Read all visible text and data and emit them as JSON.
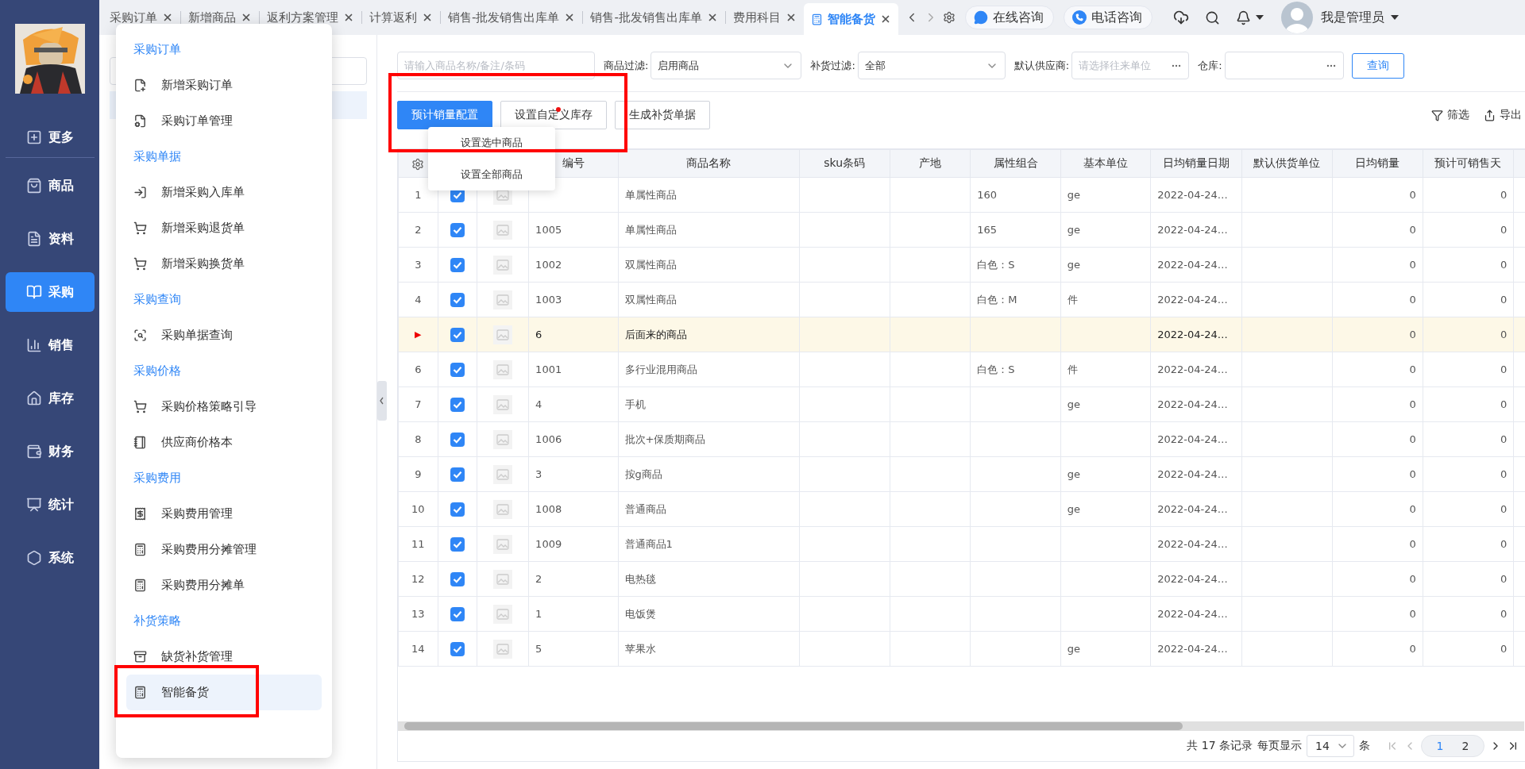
{
  "sidebar": {
    "items": [
      {
        "label": "更多",
        "selected": false
      },
      {
        "label": "商品",
        "selected": false
      },
      {
        "label": "资料",
        "selected": false
      },
      {
        "label": "采购",
        "selected": true
      },
      {
        "label": "销售",
        "selected": false
      },
      {
        "label": "库存",
        "selected": false
      },
      {
        "label": "财务",
        "selected": false
      },
      {
        "label": "统计",
        "selected": false
      },
      {
        "label": "系统",
        "selected": false
      }
    ]
  },
  "tabs": [
    {
      "label": "采购订单",
      "selected": false
    },
    {
      "label": "新增商品",
      "selected": false
    },
    {
      "label": "返利方案管理",
      "selected": false
    },
    {
      "label": "计算返利",
      "selected": false
    },
    {
      "label": "销售-批发销售出库单",
      "selected": false
    },
    {
      "label": "销售-批发销售出库单",
      "selected": false
    },
    {
      "label": "费用科目",
      "selected": false
    },
    {
      "label": "智能备货",
      "selected": true
    }
  ],
  "header": {
    "consult": [
      {
        "kind": "chat",
        "label": "在线咨询"
      },
      {
        "kind": "phone",
        "label": "电话咨询"
      }
    ],
    "user": "我是管理员"
  },
  "menu": {
    "groups": [
      {
        "title": "采购订单",
        "items": [
          {
            "label": "新增采购订单",
            "selected": false,
            "highlighted": false
          },
          {
            "label": "采购订单管理",
            "selected": false,
            "highlighted": false
          }
        ]
      },
      {
        "title": "采购单据",
        "items": [
          {
            "label": "新增采购入库单",
            "selected": false,
            "highlighted": false
          },
          {
            "label": "新增采购退货单",
            "selected": false,
            "highlighted": false
          },
          {
            "label": "新增采购换货单",
            "selected": false,
            "highlighted": false
          }
        ]
      },
      {
        "title": "采购查询",
        "items": [
          {
            "label": "采购单据查询",
            "selected": false,
            "highlighted": false
          }
        ]
      },
      {
        "title": "采购价格",
        "items": [
          {
            "label": "采购价格策略引导",
            "selected": false,
            "highlighted": false
          },
          {
            "label": "供应商价格本",
            "selected": false,
            "highlighted": false
          }
        ]
      },
      {
        "title": "采购费用",
        "items": [
          {
            "label": "采购费用管理",
            "selected": false,
            "highlighted": false
          },
          {
            "label": "采购费用分摊管理",
            "selected": false,
            "highlighted": false
          },
          {
            "label": "采购费用分摊单",
            "selected": false,
            "highlighted": false
          }
        ]
      },
      {
        "title": "补货策略",
        "items": [
          {
            "label": "缺货补货管理",
            "selected": false,
            "highlighted": false
          },
          {
            "label": "智能备货",
            "selected": true,
            "highlighted": true
          }
        ]
      }
    ]
  },
  "filters": {
    "search": {
      "placeholder": "请输入商品名称/备注/条码"
    },
    "product_filter": {
      "label": "商品过滤:",
      "value": "启用商品"
    },
    "restock_filter": {
      "label": "补货过滤:",
      "value": "全部"
    },
    "supplier": {
      "label": "默认供应商:",
      "placeholder": "请选择往来单位"
    },
    "warehouse": {
      "label": "仓库:"
    },
    "query_button": "查询"
  },
  "toolbar": {
    "highlighted": true,
    "buttons": [
      {
        "label": "预计销量配置",
        "primary": true,
        "marker": false
      },
      {
        "label": "设置自定义库存",
        "primary": false,
        "marker": true
      },
      {
        "label": "生成补货单据",
        "primary": false,
        "marker": false
      }
    ],
    "tools": [
      {
        "kind": "filter",
        "label": "筛选"
      },
      {
        "kind": "export",
        "label": "导出"
      }
    ]
  },
  "dropdown": {
    "items": [
      "设置选中商品",
      "设置全部商品"
    ]
  },
  "table": {
    "columns": [
      {
        "label": "编号"
      },
      {
        "label": "商品名称"
      },
      {
        "label": "sku条码"
      },
      {
        "label": "产地"
      },
      {
        "label": "属性组合"
      },
      {
        "label": "基本单位"
      },
      {
        "label": "日均销量日期"
      },
      {
        "label": "默认供货单位"
      },
      {
        "label": "日均销量"
      },
      {
        "label": "预计可销售天"
      }
    ],
    "rows": [
      {
        "index": "1",
        "current": false,
        "checked": true,
        "name": "单属性商品",
        "attributes": "160",
        "unit": "ge",
        "date": "2022-04-24…",
        "daily_sales": "0",
        "days": "0"
      },
      {
        "index": "2",
        "current": false,
        "checked": true,
        "code": "1005",
        "name": "单属性商品",
        "attributes": "165",
        "unit": "ge",
        "date": "2022-04-24…",
        "daily_sales": "0",
        "days": "0"
      },
      {
        "index": "3",
        "current": false,
        "checked": true,
        "code": "1002",
        "name": "双属性商品",
        "attributes": "白色：S",
        "unit": "ge",
        "date": "2022-04-24…",
        "daily_sales": "0",
        "days": "0"
      },
      {
        "index": "4",
        "current": false,
        "checked": true,
        "code": "1003",
        "name": "双属性商品",
        "attributes": "白色：M",
        "unit": "件",
        "date": "2022-04-24…",
        "daily_sales": "0",
        "days": "0"
      },
      {
        "index": "▶",
        "current": true,
        "checked": true,
        "code": "6",
        "name": "后面来的商品",
        "date": "2022-04-24…",
        "daily_sales": "0",
        "days": "0"
      },
      {
        "index": "6",
        "current": false,
        "checked": true,
        "code": "1001",
        "name": "多行业混用商品",
        "attributes": "白色：S",
        "unit": "件",
        "date": "2022-04-24…",
        "daily_sales": "0",
        "days": "0"
      },
      {
        "index": "7",
        "current": false,
        "checked": true,
        "code": "4",
        "name": "手机",
        "unit": "ge",
        "date": "2022-04-24…",
        "daily_sales": "0",
        "days": "0"
      },
      {
        "index": "8",
        "current": false,
        "checked": true,
        "code": "1006",
        "name": "批次+保质期商品",
        "date": "2022-04-24…",
        "daily_sales": "0",
        "days": "0"
      },
      {
        "index": "9",
        "current": false,
        "checked": true,
        "code": "3",
        "name": "按g商品",
        "unit": "ge",
        "date": "2022-04-24…",
        "daily_sales": "0",
        "days": "0"
      },
      {
        "index": "10",
        "current": false,
        "checked": true,
        "code": "1008",
        "name": "普通商品",
        "unit": "ge",
        "date": "2022-04-24…",
        "daily_sales": "0",
        "days": "0"
      },
      {
        "index": "11",
        "current": false,
        "checked": true,
        "code": "1009",
        "name": "普通商品1",
        "date": "2022-04-24…",
        "daily_sales": "0",
        "days": "0"
      },
      {
        "index": "12",
        "current": false,
        "checked": true,
        "code": "2",
        "name": "电热毯",
        "date": "2022-04-24…",
        "daily_sales": "0",
        "days": "0"
      },
      {
        "index": "13",
        "current": false,
        "checked": true,
        "code": "1",
        "name": "电饭煲",
        "date": "2022-04-24…",
        "daily_sales": "0",
        "days": "0"
      },
      {
        "index": "14",
        "current": false,
        "checked": true,
        "code": "5",
        "name": "苹果水",
        "unit": "ge",
        "date": "2022-04-24…",
        "daily_sales": "0",
        "days": "0"
      }
    ]
  },
  "pagination": {
    "summary": "共 17 条记录",
    "per_page_label": "每页显示",
    "per_page": "14",
    "unit": "条",
    "pages": [
      {
        "label": "1",
        "selected": true
      },
      {
        "label": "2",
        "selected": false
      }
    ]
  }
}
